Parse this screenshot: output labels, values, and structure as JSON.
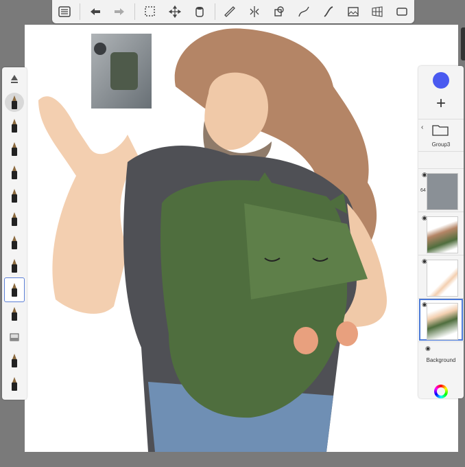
{
  "toolbar": {
    "icons": [
      "list-icon",
      "undo-icon",
      "redo-icon",
      "select-icon",
      "transform-icon",
      "fill-icon",
      "ruler-icon",
      "symmetry-icon",
      "shapes-icon",
      "curve-icon",
      "stroke-icon",
      "image-icon",
      "perspective-icon",
      "fullscreen-icon"
    ]
  },
  "left_tools": {
    "count": 14,
    "active_index": 10
  },
  "layers": {
    "current_color": "#4a5af0",
    "add_label": "+",
    "group_name": "Group3",
    "reference_opacity_label": "64",
    "background_label": "Background"
  },
  "colors": {
    "canvas": "#ffffff",
    "workspace": "#7a7a7a",
    "accent": "#4a78d6"
  }
}
